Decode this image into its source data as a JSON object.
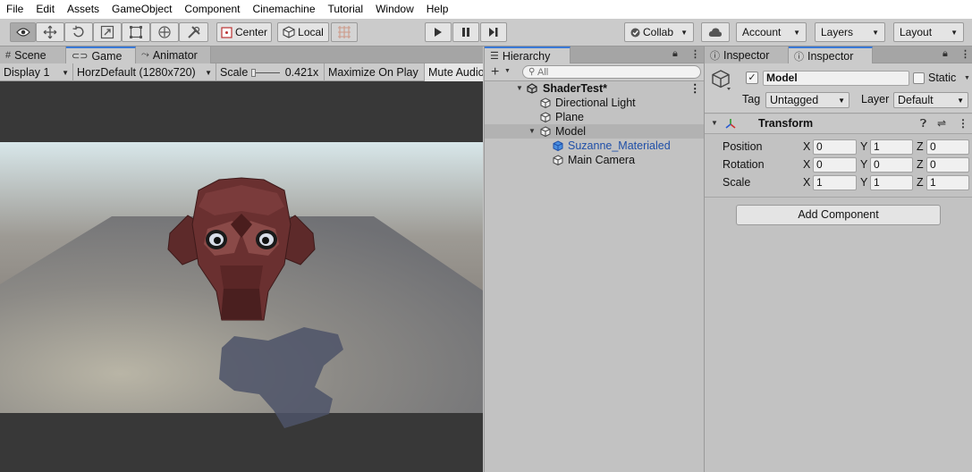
{
  "menu": [
    "File",
    "Edit",
    "Assets",
    "GameObject",
    "Component",
    "Cinemachine",
    "Tutorial",
    "Window",
    "Help"
  ],
  "toolbar": {
    "tools": [
      "view-icon",
      "move-icon",
      "rotate-icon",
      "scale-icon",
      "rect-icon",
      "transform-icon",
      "custom-tool-icon"
    ],
    "pivot_label": "Center",
    "space_label": "Local",
    "collab_label": "Collab",
    "account_label": "Account",
    "layers_label": "Layers",
    "layout_label": "Layout"
  },
  "game_panel": {
    "tabs": [
      "Scene",
      "Game",
      "Animator"
    ],
    "display": "Display 1",
    "resolution": "HorzDefault (1280x720)",
    "scale_label": "Scale",
    "scale_value": "0.421x",
    "maximize_label": "Maximize On Play",
    "mute_label": "Mute Audio"
  },
  "hierarchy": {
    "tab": "Hierarchy",
    "search_placeholder": "All",
    "scene_name": "ShaderTest*",
    "items": [
      {
        "label": "Directional Light"
      },
      {
        "label": "Plane"
      },
      {
        "label": "Model"
      },
      {
        "label": "Suzanne_Materialed"
      },
      {
        "label": "Main Camera"
      }
    ]
  },
  "inspector": {
    "tabs": [
      "Inspector",
      "Inspector"
    ],
    "object_name": "Model",
    "static_label": "Static",
    "tag_label": "Tag",
    "tag_value": "Untagged",
    "layer_label": "Layer",
    "layer_value": "Default",
    "transform_title": "Transform",
    "rows": [
      {
        "label": "Position",
        "x": "0",
        "y": "1",
        "z": "0"
      },
      {
        "label": "Rotation",
        "x": "0",
        "y": "0",
        "z": "0"
      },
      {
        "label": "Scale",
        "x": "1",
        "y": "1",
        "z": "1"
      }
    ],
    "axis": {
      "x": "X",
      "y": "Y",
      "z": "Z"
    },
    "add_component_label": "Add Component"
  },
  "colors": {
    "accent_tab": "#3a79d6",
    "selected_child_text": "#1f4fa8",
    "panel_bg": "#c2c2c2"
  }
}
